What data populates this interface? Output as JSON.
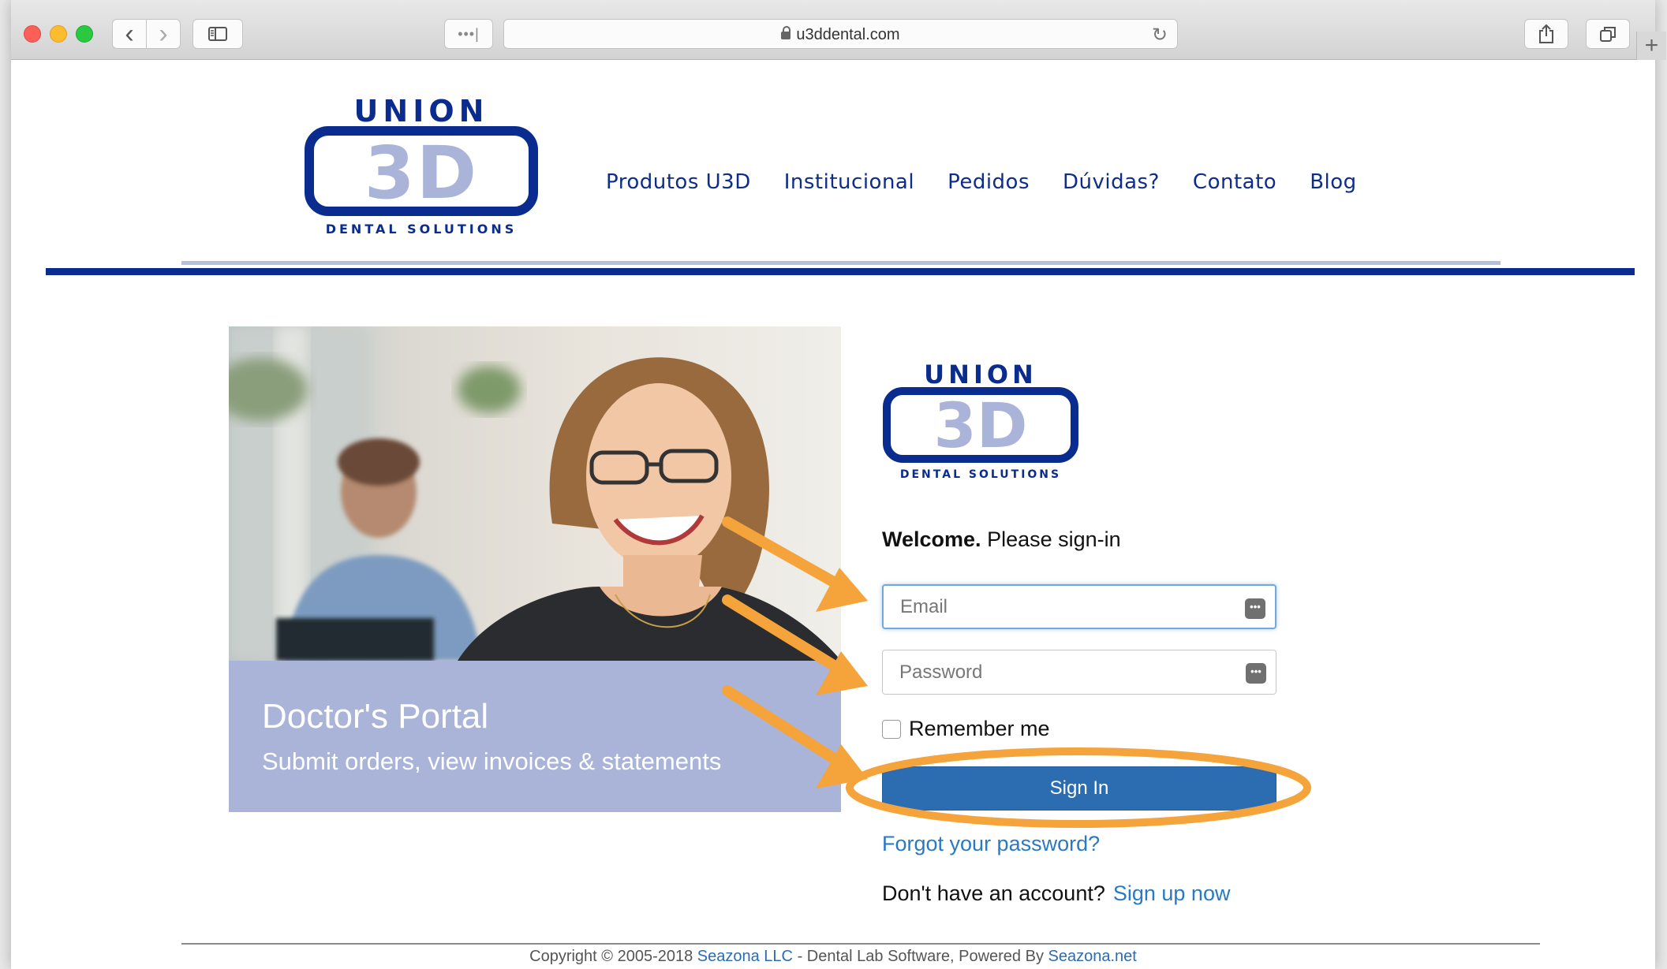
{
  "browser": {
    "url": "u3ddental.com",
    "dots": "•••|",
    "reload": "↻",
    "back": "‹",
    "forward": "›",
    "plus": "+"
  },
  "logo": {
    "top_word": "UNION",
    "mark": "3D",
    "tagline": "DENTAL SOLUTIONS"
  },
  "nav": {
    "items": [
      "Produtos U3D",
      "Institucional",
      "Pedidos",
      "Dúvidas?",
      "Contato",
      "Blog"
    ]
  },
  "hero": {
    "title": "Doctor's Portal",
    "subtitle": "Submit orders, view invoices & statements"
  },
  "login": {
    "welcome_bold": "Welcome.",
    "welcome_rest": "Please sign-in",
    "email_placeholder": "Email",
    "password_placeholder": "Password",
    "key_icon": "•••",
    "remember_label": "Remember me",
    "signin_label": "Sign In",
    "forgot_label": "Forgot your password?",
    "no_account_label": "Don't have an account?",
    "signup_label": "Sign up now"
  },
  "footer": {
    "prefix": "Copyright © 2005-2018",
    "company": "Seazona LLC",
    "middle": "- Dental Lab Software, Powered By",
    "site": "Seazona.net"
  },
  "colors": {
    "brand_navy": "#0a2c8e",
    "brand_light": "#aab4d9",
    "button_blue": "#2c6db2",
    "link_blue": "#2a79c4",
    "annotation_orange": "#f5a33b"
  }
}
